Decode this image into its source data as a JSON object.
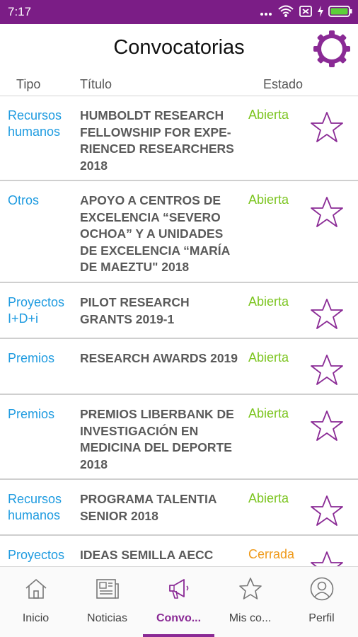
{
  "status_bar": {
    "time": "7:17",
    "bg_color": "#7b1d86"
  },
  "header": {
    "title": "Convocatorias",
    "settings_icon": "gear-icon",
    "accent_color": "#8a2a95"
  },
  "columns": {
    "tipo": "Tipo",
    "titulo": "Título",
    "estado": "Estado"
  },
  "rows": [
    {
      "tipo": "Recursos humanos",
      "titulo": "HUMBOLDT RESEARCH FELLOWSHIP FOR EXPE-RIENCED RESEARCHERS 2018",
      "estado": "Abierta",
      "favorite": false
    },
    {
      "tipo": "Otros",
      "titulo": "APOYO A CENTROS DE EXCELENCIA “SEVERO OCHOA” Y A UNIDADES DE EXCELENCIA “MARÍA DE MAEZTU\" 2018",
      "estado": "Abierta",
      "favorite": false
    },
    {
      "tipo": "Proyectos I+D+i",
      "titulo": "PILOT RESEARCH GRANTS 2019-1",
      "estado": "Abierta",
      "favorite": false
    },
    {
      "tipo": "Premios",
      "titulo": "RESEARCH AWARDS 2019",
      "estado": "Abierta",
      "favorite": false
    },
    {
      "tipo": "Premios",
      "titulo": "PREMIOS LIBERBANK DE INVESTIGACIÓN EN MEDICINA DEL DEPORTE 2018",
      "estado": "Abierta",
      "favorite": false
    },
    {
      "tipo": "Recursos humanos",
      "titulo": "PROGRAMA TALENTIA SENIOR 2018",
      "estado": "Abierta",
      "favorite": false
    },
    {
      "tipo": "Proyectos",
      "titulo": "IDEAS SEMILLA AECC",
      "estado": "Cerrada",
      "favorite": false
    }
  ],
  "status_colors": {
    "open": "#7cc520",
    "closed": "#ef9a1a"
  },
  "tabs": [
    {
      "label": "Inicio",
      "icon": "home-icon",
      "active": false
    },
    {
      "label": "Noticias",
      "icon": "newspaper-icon",
      "active": false
    },
    {
      "label": "Convo...",
      "icon": "megaphone-icon",
      "active": true
    },
    {
      "label": "Mis co...",
      "icon": "star-icon",
      "active": false
    },
    {
      "label": "Perfil",
      "icon": "user-icon",
      "active": false
    }
  ]
}
